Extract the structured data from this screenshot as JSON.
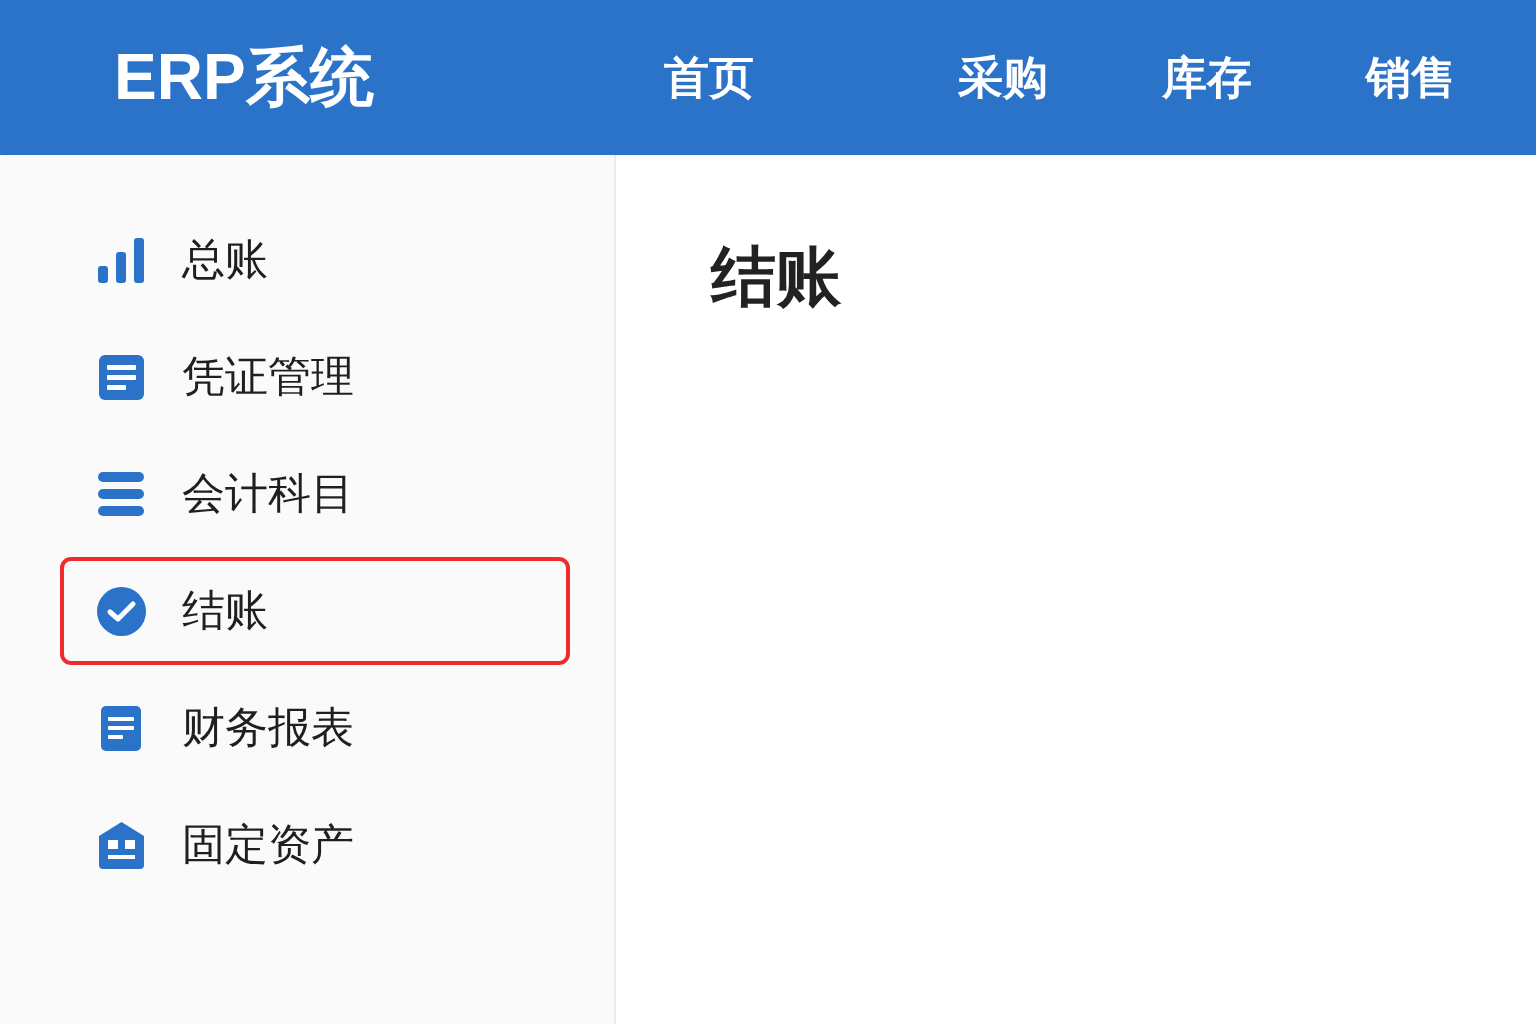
{
  "header": {
    "logo": "ERP系统",
    "nav": [
      {
        "label": "首页"
      },
      {
        "label": "采购"
      },
      {
        "label": "库存"
      },
      {
        "label": "销售"
      }
    ]
  },
  "sidebar": {
    "items": [
      {
        "label": "总账",
        "kind": "chart",
        "selected": false
      },
      {
        "label": "凭证管理",
        "kind": "document",
        "selected": false
      },
      {
        "label": "会计科目",
        "kind": "list",
        "selected": false
      },
      {
        "label": "结账",
        "kind": "check",
        "selected": true
      },
      {
        "label": "财务报表",
        "kind": "report",
        "selected": false
      },
      {
        "label": "固定资产",
        "kind": "building",
        "selected": false
      }
    ]
  },
  "main": {
    "title": "结账"
  }
}
